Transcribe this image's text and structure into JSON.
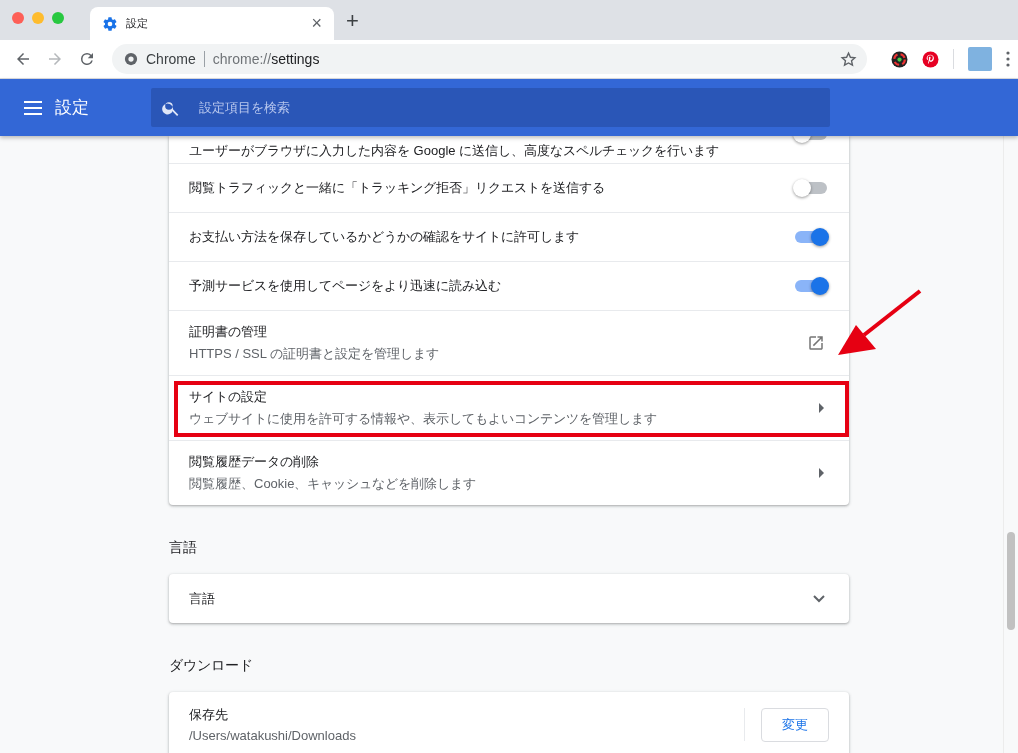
{
  "tab": {
    "title": "設定",
    "close": "×"
  },
  "new_tab": "+",
  "omnibox": {
    "origin": "Chrome",
    "url_scheme": "chrome://",
    "url_host": "settings"
  },
  "header": {
    "title": "設定",
    "search": {
      "placeholder": "設定項目を検索"
    }
  },
  "privacy_rows": [
    {
      "kind": "toggle",
      "title": "ユーザーがブラウザに入力した内容を Google に送信し、高度なスペルチェックを行います",
      "on": false,
      "highlighted": false
    },
    {
      "kind": "toggle",
      "title": "閲覧トラフィックと一緒に「トラッキング拒否」リクエストを送信する",
      "on": false,
      "highlighted": false
    },
    {
      "kind": "toggle",
      "title": "お支払い方法を保存しているかどうかの確認をサイトに許可します",
      "on": true,
      "highlighted": false
    },
    {
      "kind": "toggle",
      "title": "予測サービスを使用してページをより迅速に読み込む",
      "on": true,
      "highlighted": false
    },
    {
      "kind": "external",
      "title": "証明書の管理",
      "subtitle": "HTTPS / SSL の証明書と設定を管理します",
      "highlighted": false
    },
    {
      "kind": "arrow",
      "title": "サイトの設定",
      "subtitle": "ウェブサイトに使用を許可する情報や、表示してもよいコンテンツを管理します",
      "highlighted": true
    },
    {
      "kind": "arrow",
      "title": "閲覧履歴データの削除",
      "subtitle": "閲覧履歴、Cookie、キャッシュなどを削除します",
      "highlighted": false
    }
  ],
  "language": {
    "heading": "言語",
    "row": {
      "title": "言語",
      "expanded": false
    }
  },
  "downloads": {
    "heading": "ダウンロード",
    "row": {
      "title": "保存先",
      "subtitle": "/Users/watakushi/Downloads",
      "button": "変更"
    }
  }
}
